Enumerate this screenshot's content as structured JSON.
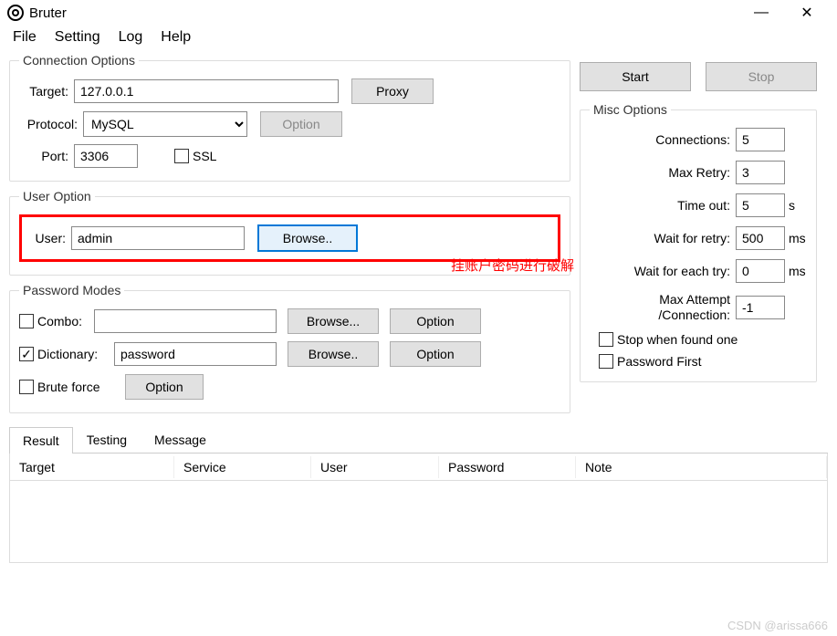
{
  "titlebar": {
    "title": "Bruter"
  },
  "menubar": [
    "File",
    "Setting",
    "Log",
    "Help"
  ],
  "connection": {
    "legend": "Connection Options",
    "target_label": "Target:",
    "target_value": "127.0.0.1",
    "proxy_button": "Proxy",
    "protocol_label": "Protocol:",
    "protocol_value": "MySQL",
    "option_button": "Option",
    "port_label": "Port:",
    "port_value": "3306",
    "ssl_label": "SSL"
  },
  "user_option": {
    "legend": "User Option",
    "user_label": "User:",
    "user_value": "admin",
    "browse_button": "Browse..",
    "annotation": "挂账户密码进行破解"
  },
  "password_modes": {
    "legend": "Password Modes",
    "combo_label": "Combo:",
    "combo_value": "",
    "combo_browse": "Browse...",
    "combo_option": "Option",
    "dict_label": "Dictionary:",
    "dict_value": "password",
    "dict_browse": "Browse..",
    "dict_option": "Option",
    "brute_label": "Brute force",
    "brute_option": "Option"
  },
  "actions": {
    "start": "Start",
    "stop": "Stop"
  },
  "misc": {
    "legend": "Misc Options",
    "connections_label": "Connections:",
    "connections_value": "5",
    "max_retry_label": "Max Retry:",
    "max_retry_value": "3",
    "timeout_label": "Time out:",
    "timeout_value": "5",
    "timeout_unit": "s",
    "wait_retry_label": "Wait for retry:",
    "wait_retry_value": "500",
    "wait_retry_unit": "ms",
    "wait_each_label": "Wait for each try:",
    "wait_each_value": "0",
    "wait_each_unit": "ms",
    "max_attempt_label_1": "Max Attempt",
    "max_attempt_label_2": "/Connection:",
    "max_attempt_value": "-1",
    "stop_found_label": "Stop when found one",
    "password_first_label": "Password First"
  },
  "tabs": [
    "Result",
    "Testing",
    "Message"
  ],
  "table": {
    "headers": [
      "Target",
      "Service",
      "User",
      "Password",
      "Note"
    ]
  },
  "watermark": "CSDN @arissa666"
}
